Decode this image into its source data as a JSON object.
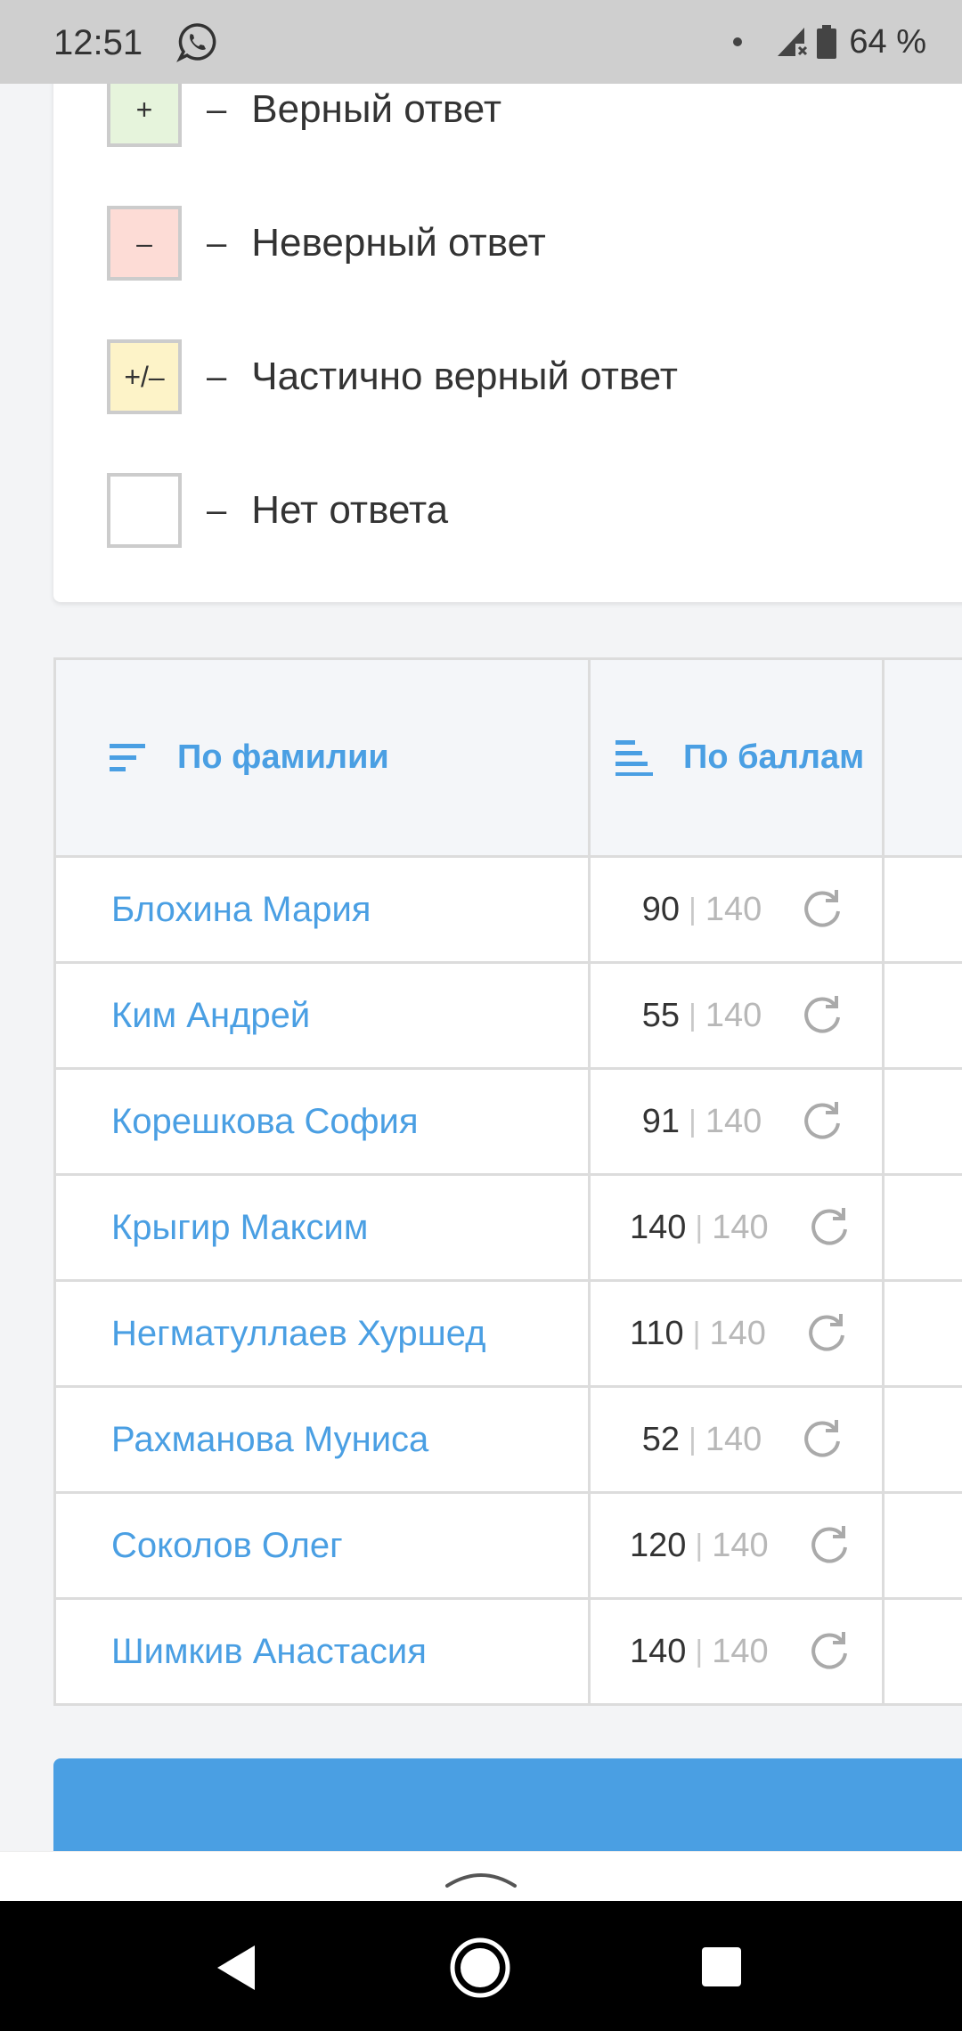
{
  "status_bar": {
    "time": "12:51",
    "battery": "64 %"
  },
  "legend": [
    {
      "symbol": "+",
      "label": "Верный ответ",
      "color": "#e6f4dc"
    },
    {
      "symbol": "–",
      "label": "Неверный ответ",
      "color": "#fddcd6"
    },
    {
      "symbol": "+/–",
      "label": "Частично верный ответ",
      "color": "#fdf3c8"
    },
    {
      "symbol": "",
      "label": "Нет ответа",
      "color": "#ffffff"
    }
  ],
  "legend_separator": "–",
  "table": {
    "headers": {
      "by_surname": "По фамилии",
      "by_score": "По баллам"
    },
    "score_separator": "|",
    "rows": [
      {
        "name": "Блохина Мария",
        "score": "90",
        "max": "140"
      },
      {
        "name": "Ким Андрей",
        "score": "55",
        "max": "140"
      },
      {
        "name": "Корешкова София",
        "score": "91",
        "max": "140"
      },
      {
        "name": "Крыгир Максим",
        "score": "140",
        "max": "140"
      },
      {
        "name": "Негматуллаев Хуршед",
        "score": "110",
        "max": "140"
      },
      {
        "name": "Рахманова Муниса",
        "score": "52",
        "max": "140"
      },
      {
        "name": "Соколов Олег",
        "score": "120",
        "max": "140"
      },
      {
        "name": "Шимкив Анастасия",
        "score": "140",
        "max": "140"
      }
    ]
  },
  "icons": {
    "sort": "sort-lines-icon",
    "reload": "reload-icon",
    "handle": "chevron-up-icon"
  },
  "colors": {
    "accent": "#4a9fe3",
    "status_bar": "#cfcfcf",
    "border": "#dcdcdc"
  }
}
